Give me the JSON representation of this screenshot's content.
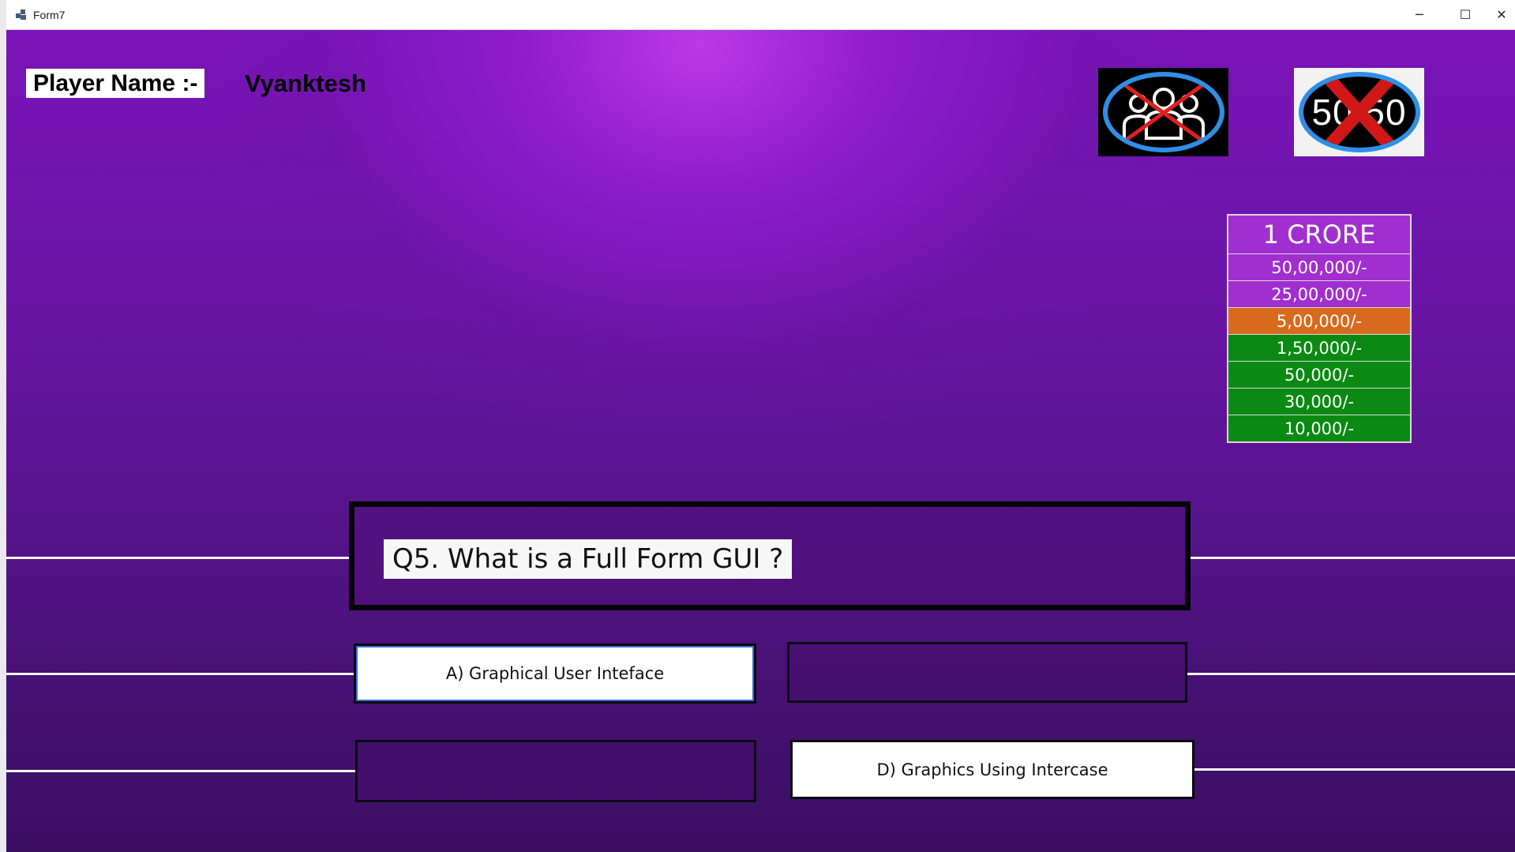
{
  "window": {
    "title": "Form7",
    "minimize_glyph": "─",
    "maximize_glyph": "☐",
    "close_glyph": "✕"
  },
  "player": {
    "label": "Player Name :-",
    "name": "Vyanktesh"
  },
  "lifelines": {
    "audience_poll": {
      "icon": "audience-poll-icon",
      "used": true
    },
    "fifty_fifty": {
      "icon": "fifty-fifty-icon",
      "text": "50 50",
      "used": true
    }
  },
  "prize_ladder": [
    {
      "amount": "1 CRORE",
      "color": "#a12fd0"
    },
    {
      "amount": "50,00,000/-",
      "color": "#a12fd0"
    },
    {
      "amount": "25,00,000/-",
      "color": "#a12fd0"
    },
    {
      "amount": "5,00,000/-",
      "color": "#d86a1e"
    },
    {
      "amount": "1,50,000/-",
      "color": "#0a8a12"
    },
    {
      "amount": "50,000/-",
      "color": "#0a8a12"
    },
    {
      "amount": "30,000/-",
      "color": "#0a8a12"
    },
    {
      "amount": "10,000/-",
      "color": "#0a8a12"
    }
  ],
  "question": {
    "text": "Q5. What is a Full Form GUI ?"
  },
  "options": {
    "a": "A) Graphical User Inteface",
    "b": "",
    "c": "",
    "d": "D) Graphics Using Intercase"
  },
  "colors": {
    "background_top": "#7a14b8",
    "background_glow": "#be3ce6",
    "lifeline_ring": "#2f8fe6",
    "cross": "#e02020"
  }
}
